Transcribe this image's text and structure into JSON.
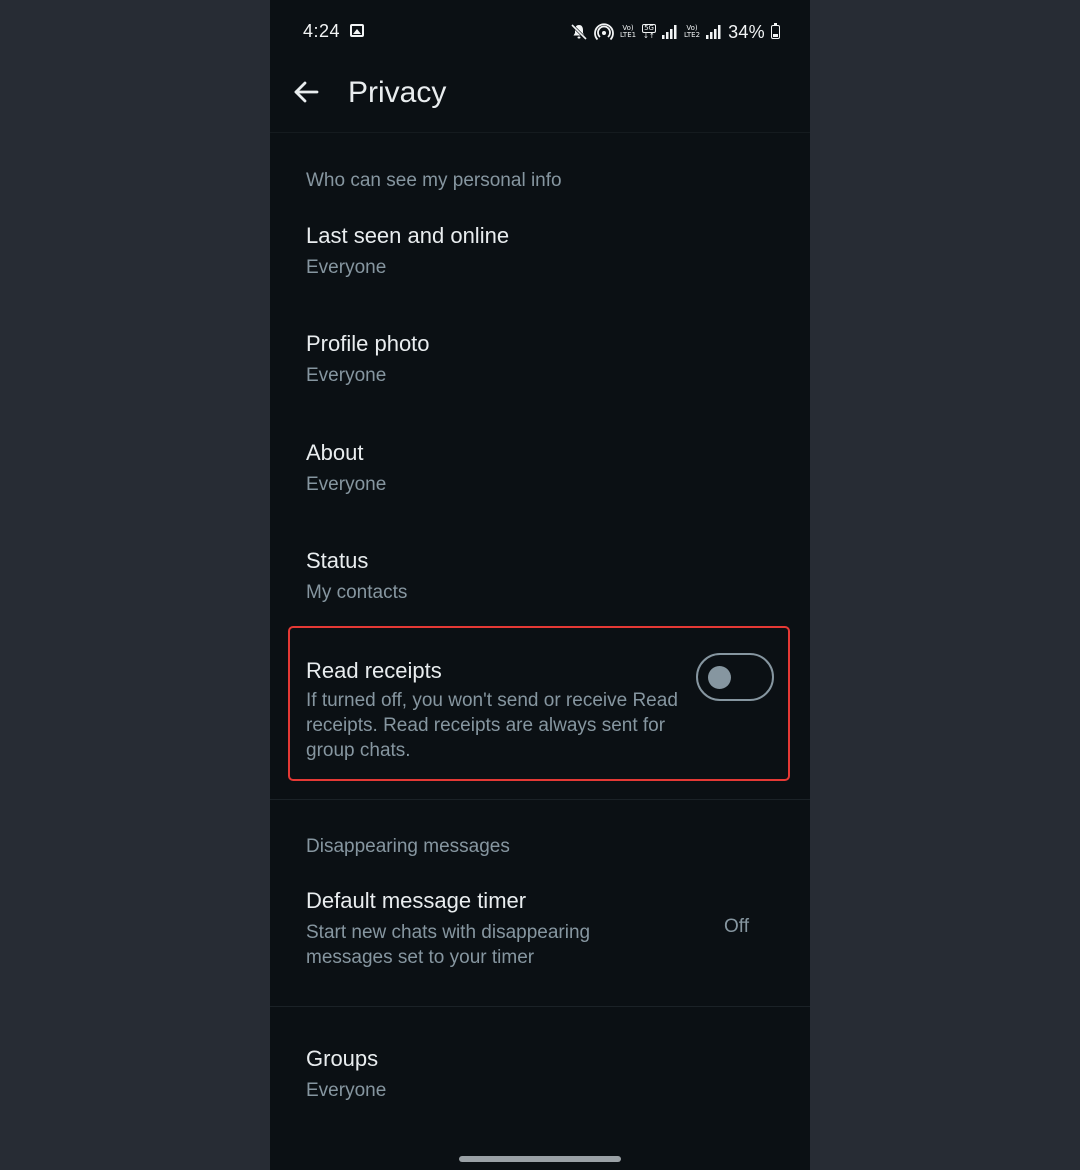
{
  "status_bar": {
    "time": "4:24",
    "lte1_label_top": "Vo)",
    "lte1_label_bottom": "LTE1",
    "net5g_label_top": "5G",
    "lte2_label_top": "Vo)",
    "lte2_label_bottom": "LTE2",
    "battery": "34%",
    "battery_level": 0.34,
    "icons": [
      "image-icon",
      "mute-icon",
      "hotspot-icon",
      "signal-icon",
      "battery-icon"
    ]
  },
  "app_bar": {
    "title": "Privacy",
    "back_icon": "arrow-left-icon"
  },
  "personal_info": {
    "header": "Who can see my personal info",
    "items": [
      {
        "title": "Last seen and online",
        "value": "Everyone"
      },
      {
        "title": "Profile photo",
        "value": "Everyone"
      },
      {
        "title": "About",
        "value": "Everyone"
      },
      {
        "title": "Status",
        "value": "My contacts"
      }
    ]
  },
  "read_receipts": {
    "title": "Read receipts",
    "description": "If turned off, you won't send or receive Read receipts. Read receipts are always sent for group chats.",
    "enabled": false,
    "highlight_color": "#e53935"
  },
  "disappearing": {
    "header": "Disappearing messages",
    "timer_title": "Default message timer",
    "timer_description": "Start new chats with disappearing messages set to your timer",
    "timer_value": "Off"
  },
  "groups": {
    "title": "Groups",
    "value": "Everyone"
  },
  "colors": {
    "background": "#0b1014",
    "primary_text": "#e9edef",
    "secondary_text": "#8696a0",
    "outer_background": "#272c34"
  }
}
